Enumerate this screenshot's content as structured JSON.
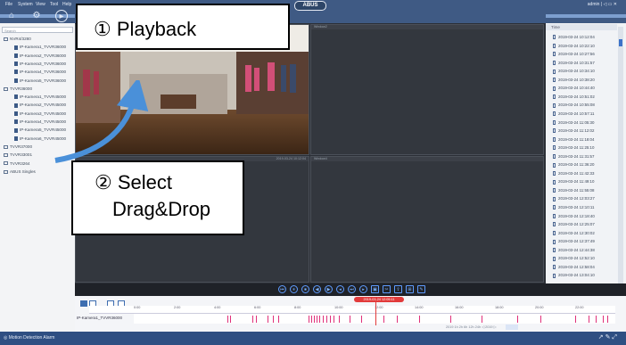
{
  "menu": [
    "File",
    "System",
    "View",
    "Tool",
    "Help"
  ],
  "nav_icons": [
    "home-icon",
    "settings-icon",
    "playback-icon"
  ],
  "logo": "ABUS",
  "top_right": "admin  | ◁  ▭  ✕",
  "tree": {
    "search_placeholder": "Search",
    "items": [
      {
        "label": "NVR4/3280",
        "kind": "group"
      },
      {
        "label": "IP-Kamera1_TVVR36000",
        "kind": "cam"
      },
      {
        "label": "IP-Kamera2_TVVR36000",
        "kind": "cam"
      },
      {
        "label": "IP-Kamera3_TVVR36000",
        "kind": "cam"
      },
      {
        "label": "IP-Kamera4_TVVR36000",
        "kind": "cam"
      },
      {
        "label": "IP-Kamera5_TVVR36000",
        "kind": "cam"
      },
      {
        "label": "TVVR36000",
        "kind": "group"
      },
      {
        "label": "IP-Kamera1_TVVR45000",
        "kind": "cam"
      },
      {
        "label": "IP-Kamera2_TVVR45000",
        "kind": "cam"
      },
      {
        "label": "IP-Kamera3_TVVR45000",
        "kind": "cam"
      },
      {
        "label": "IP-Kamera4_TVVR45000",
        "kind": "cam"
      },
      {
        "label": "IP-Kamera5_TVVR45000",
        "kind": "cam"
      },
      {
        "label": "IP-Kamera6_TVVR45000",
        "kind": "cam"
      },
      {
        "label": "TVVR37000",
        "kind": "group"
      },
      {
        "label": "TVVR33001",
        "kind": "group"
      },
      {
        "label": "TVVR3264",
        "kind": "group"
      },
      {
        "label": "ABUS Singles",
        "kind": "group"
      }
    ]
  },
  "grid": {
    "cell1": "2019-03-24 10:12:04",
    "cell2": "Window2",
    "cell3": "2019-03-24 10:12:04",
    "cell4": "Window4"
  },
  "right_panel": {
    "header": "Time",
    "rows": [
      "2019-03-24 10:12:04",
      "2019-03-24 10:22:10",
      "2019-03-24 10:27:56",
      "2019-03-24 10:31:57",
      "2019-03-24 10:34:10",
      "2019-03-24 10:38:20",
      "2019-03-24 10:44:40",
      "2019-03-24 10:51:02",
      "2019-03-24 10:55:08",
      "2019-03-24 10:57:11",
      "2019-03-24 11:05:30",
      "2019-03-24 11:12:02",
      "2019-03-24 11:18:04",
      "2019-03-24 11:25:10",
      "2019-03-24 11:31:57",
      "2019-03-24 11:36:20",
      "2019-03-24 11:42:33",
      "2019-03-24 11:49:10",
      "2019-03-24 11:55:08",
      "2019-03-24 12:03:27",
      "2019-03-24 12:10:11",
      "2019-03-24 12:18:40",
      "2019-03-24 12:25:07",
      "2019-03-24 12:30:02",
      "2019-03-24 12:37:49",
      "2019-03-24 12:44:38",
      "2019-03-24 12:52:10",
      "2019-03-24 12:58:04",
      "2019-03-24 13:04:10"
    ]
  },
  "controls": [
    "prev-icon",
    "pause-icon",
    "stop-icon",
    "rewind-icon",
    "forward-icon",
    "slow-icon",
    "next-frame-icon",
    "fast-icon",
    "snapshot-icon",
    "clip-icon",
    "export-icon",
    "tag-icon",
    "tools-icon"
  ],
  "timeline": {
    "cursor": "2019-03-24 12:05:11",
    "camera": "IP-Kamera1_TVVR36000",
    "ticks": [
      "0:00",
      "2:00",
      "4:00",
      "6:00",
      "8:00",
      "10:00",
      "12:00",
      "14:00",
      "16:00",
      "18:00",
      "20:00",
      "22:00"
    ],
    "footer": "2019  1h  2h  6h  12h  24h  ◁  2019  ▷"
  },
  "status": {
    "text": "Motion Detection Alarm",
    "right": "↗  ✎  ⤢"
  },
  "callouts": {
    "step1": "① Playback",
    "step2_line1": "② Select",
    "step2_line2": "Drag&Drop"
  },
  "colors": {
    "topbar": "#3f5a84",
    "accent": "#5f9cff",
    "event_marker": "#e0307a",
    "cursor": "#e23a3a"
  }
}
